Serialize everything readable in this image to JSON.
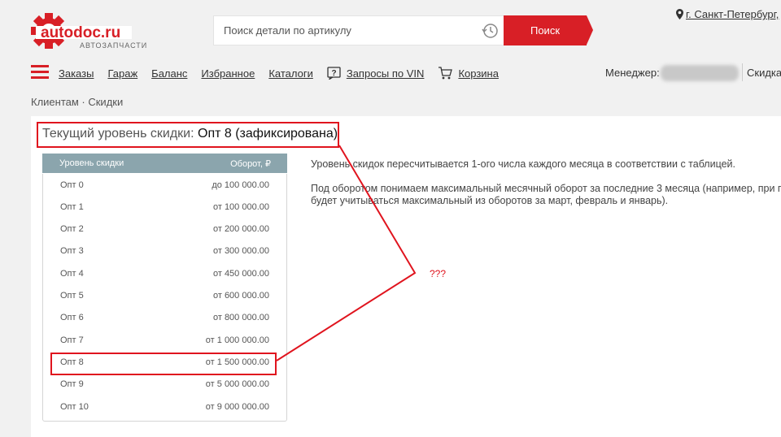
{
  "header": {
    "logo_text": "autodoc.ru",
    "logo_subtext": "автозапчасти",
    "search_placeholder": "Поиск детали по артикулу",
    "search_button": "Поиск",
    "city": "г. Санкт-Петербург,"
  },
  "nav": {
    "items": [
      {
        "label": "Заказы"
      },
      {
        "label": "Гараж"
      },
      {
        "label": "Баланс"
      },
      {
        "label": "Избранное"
      },
      {
        "label": "Каталоги"
      },
      {
        "label": "Запросы по VIN",
        "icon": "question-icon"
      },
      {
        "label": "Корзина",
        "icon": "cart-icon"
      }
    ],
    "manager_label": "Менеджер:",
    "discounts_label": "Скидка"
  },
  "breadcrumb": "Клиентам · Скидки",
  "current_level": {
    "label": "Текущий уровень скидки:",
    "value": "Опт 8 (зафиксирована)"
  },
  "table": {
    "headers": [
      "Уровень скидки",
      "Оборот, ₽"
    ],
    "rows": [
      {
        "level": "Опт 0",
        "turnover": "до 100 000.00"
      },
      {
        "level": "Опт 1",
        "turnover": "от 100 000.00"
      },
      {
        "level": "Опт 2",
        "turnover": "от 200 000.00"
      },
      {
        "level": "Опт 3",
        "turnover": "от 300 000.00"
      },
      {
        "level": "Опт 4",
        "turnover": "от 450 000.00"
      },
      {
        "level": "Опт 5",
        "turnover": "от 600 000.00"
      },
      {
        "level": "Опт 6",
        "turnover": "от 800 000.00"
      },
      {
        "level": "Опт 7",
        "turnover": "от 1 000 000.00"
      },
      {
        "level": "Опт 8",
        "turnover": "от 1 500 000.00"
      },
      {
        "level": "Опт 9",
        "turnover": "от 5 000 000.00"
      },
      {
        "level": "Опт 10",
        "turnover": "от 9 000 000.00"
      }
    ]
  },
  "info": {
    "p1": "Уровень скидок пересчитывается 1-ого числа каждого месяца в соответствии с таблицей.",
    "p2_line1": "Под оборотом понимаем максимальный месячный оборот за последние 3 месяца (например, при п",
    "p2_line2": "будет учитываться максимальный из оборотов за март, февраль и январь)."
  },
  "annotation": "???",
  "colors": {
    "brand_red": "#d81f26",
    "table_header": "#8ba5ad",
    "highlight": "#e0141e"
  }
}
